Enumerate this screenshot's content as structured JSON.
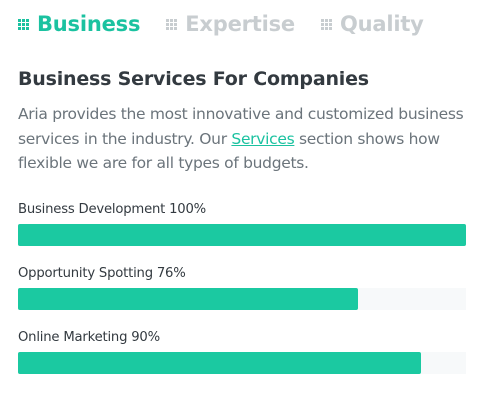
{
  "tabs": [
    {
      "label": "Business",
      "icon": "grid-icon",
      "active": true
    },
    {
      "label": "Expertise",
      "icon": "grid-icon",
      "active": false
    },
    {
      "label": "Quality",
      "icon": "grid-icon",
      "active": false
    }
  ],
  "content": {
    "heading": "Business Services For Companies",
    "description_before": "Aria provides the most innovative and customized business services in the industry. Our ",
    "description_link": "Services",
    "description_after": " section shows how flexible we are for all types of budgets."
  },
  "skills": [
    {
      "label": "Business Development 100%",
      "percent": 100
    },
    {
      "label": "Opportunity Spotting 76%",
      "percent": 76
    },
    {
      "label": "Online Marketing 90%",
      "percent": 90
    }
  ],
  "colors": {
    "accent": "#1bc2a0",
    "bar_fill": "#1bc9a1",
    "bar_track": "#f7f9fa",
    "inactive_tab": "#c8cdd0",
    "heading": "#333a40",
    "body_text": "#6b747b"
  }
}
